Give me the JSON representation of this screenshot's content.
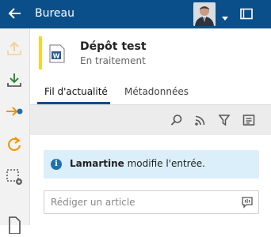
{
  "app": {
    "title": "Bureau",
    "colors": {
      "topbar": "#0b4f8a",
      "accent": "#f5d62a",
      "info_bg": "#dbeffb",
      "orange": "#f39200",
      "green": "#2e8b3a",
      "blue": "#1f6fb2"
    }
  },
  "header": {
    "back_icon": "arrow-left-icon",
    "avatar": "user-avatar",
    "dropdown_icon": "caret-down-icon",
    "panel_icon": "panel-toggle-icon"
  },
  "sidebar": {
    "items": [
      {
        "icon": "upload-icon",
        "state": "disabled"
      },
      {
        "icon": "download-icon"
      },
      {
        "icon": "arrow-to-dot-icon"
      },
      {
        "icon": "refresh-icon"
      },
      {
        "icon": "selection-settings-icon"
      },
      {
        "icon": "document-icon"
      }
    ]
  },
  "document": {
    "name": "Dépôt test",
    "status": "En traitement",
    "type_icon": "word-document-icon"
  },
  "tabs": [
    {
      "label": "Fil d'actualité",
      "active": true
    },
    {
      "label": "Métadonnées",
      "active": false
    }
  ],
  "feed_toolbar": {
    "tools": [
      "search-icon",
      "rss-icon",
      "filter-icon",
      "list-view-icon"
    ]
  },
  "feed": {
    "entry_user": "Lamartine",
    "entry_action": " modifie l'entrée."
  },
  "composer": {
    "placeholder": "Rédiger un article",
    "icon": "speech-bubble-icon"
  }
}
